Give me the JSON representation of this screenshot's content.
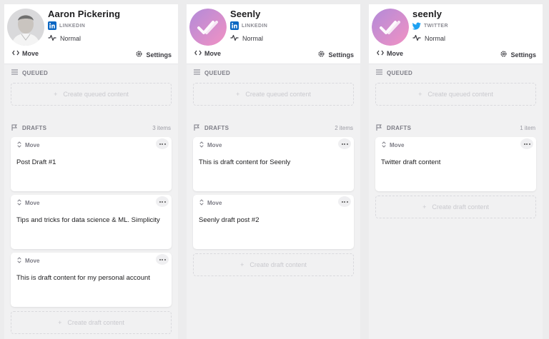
{
  "colors": {
    "linkedin": "#0a66c2",
    "twitter": "#1da1f2",
    "brand_gradient_start": "#b18ad8",
    "brand_gradient_end": "#f08fc4"
  },
  "columns": [
    {
      "name": "Aaron Pickering",
      "network": "LINKEDIN",
      "network_icon": "linkedin-icon",
      "mode": "Normal",
      "move_label": "Move",
      "settings_label": "Settings",
      "queued_label": "QUEUED",
      "create_queued_label": "Create queued content",
      "drafts_label": "DRAFTS",
      "drafts_count": "3 items",
      "drafts": [
        {
          "move": "Move",
          "text": "Post Draft #1"
        },
        {
          "move": "Move",
          "text": "Tips and tricks for data science & ML. Simplicity"
        },
        {
          "move": "Move",
          "text": "This is draft content for my personal account"
        }
      ],
      "create_draft_label": "Create draft content"
    },
    {
      "name": "Seenly",
      "network": "LINKEDIN",
      "network_icon": "linkedin-icon",
      "mode": "Normal",
      "move_label": "Move",
      "settings_label": "Settings",
      "queued_label": "QUEUED",
      "create_queued_label": "Create queued content",
      "drafts_label": "DRAFTS",
      "drafts_count": "2 items",
      "drafts": [
        {
          "move": "Move",
          "text": "This is draft content for Seenly"
        },
        {
          "move": "Move",
          "text": "Seenly draft post #2"
        }
      ],
      "create_draft_label": "Create draft content"
    },
    {
      "name": "seenly",
      "network": "TWITTER",
      "network_icon": "twitter-icon",
      "mode": "Normal",
      "move_label": "Move",
      "settings_label": "Settings",
      "queued_label": "QUEUED",
      "create_queued_label": "Create queued content",
      "drafts_label": "DRAFTS",
      "drafts_count": "1 item",
      "drafts": [
        {
          "move": "Move",
          "text": "Twitter draft content"
        }
      ],
      "create_draft_label": "Create draft content"
    }
  ]
}
